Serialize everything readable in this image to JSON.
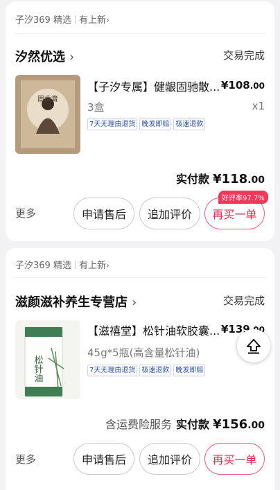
{
  "orders": [
    {
      "source": {
        "label": "子汐369 精选",
        "link": "有上新"
      },
      "shop_name": "汐然优选",
      "status": "交易完成",
      "product": {
        "title": "【子汐专属】健龈固驰散...",
        "price_major": "¥108",
        "price_minor": ".00",
        "spec": "3盒",
        "quantity": "x1",
        "tags": [
          "7天无理由退货",
          "晚发即赔",
          "极速退款"
        ],
        "thumb_text": "固齿膏"
      },
      "paid_label": "实付款",
      "paid_major": "¥118",
      "paid_minor": ".00",
      "insurance": "",
      "more": "更多",
      "buttons": {
        "after_sale": "申请售后",
        "review": "追加评价",
        "rebuy": "再买一单"
      },
      "badge": "好评率97.7%"
    },
    {
      "source": {
        "label": "子汐369 精选",
        "link": "有上新"
      },
      "shop_name": "滋颜滋补养生专营店",
      "status": "交易完成",
      "product": {
        "title": "【滋禧堂】松针油软胶囊...",
        "price_major": "¥139",
        "price_minor": ".00",
        "spec": "45g*5瓶(高含量松针油)",
        "quantity": "",
        "tags": [
          "7天无理由退货",
          "极速退款",
          "晚发即赔"
        ],
        "thumb_text": "松针油"
      },
      "paid_label": "实付款",
      "paid_major": "¥156",
      "paid_minor": ".00",
      "insurance": "含运费险服务",
      "more": "更多",
      "buttons": {
        "after_sale": "申请售后",
        "review": "追加评价",
        "rebuy": "再买一单"
      }
    }
  ],
  "colors": {
    "accent": "#e8294d",
    "tag_text": "#2a4fa8",
    "background": "#f2f2f4"
  },
  "icons": {
    "scroll_top": "arrow-up-to-top-icon",
    "shop_arrow": "chevron-right-icon"
  }
}
